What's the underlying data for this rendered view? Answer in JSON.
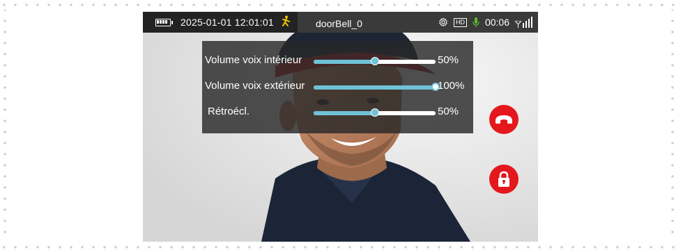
{
  "status_bar": {
    "datetime": "2025-01-01 12:01:01",
    "device_name": "doorBell_0",
    "hd_badge": "HD",
    "call_timer": "00:06"
  },
  "settings_panel": {
    "rows": [
      {
        "label": "Volume voix intérieur",
        "value_text": "50%",
        "value": 0.5
      },
      {
        "label": "Volume voix extérieur",
        "value_text": "100%",
        "value": 1.0
      },
      {
        "label": "Rétroécl.",
        "value_text": "50%",
        "value": 0.5
      }
    ]
  },
  "colors": {
    "slider_fill": "#6fc2d6",
    "action_red": "#e4171d",
    "motion_icon": "#f2c200",
    "mic_green": "#5dbb2a"
  },
  "icons": {
    "battery": "battery-icon",
    "motion": "walking-person-icon",
    "settings": "gear-icon",
    "mic": "microphone-icon",
    "signal": "signal-icon",
    "hangup": "hang-up-icon",
    "unlock": "lock-icon"
  }
}
